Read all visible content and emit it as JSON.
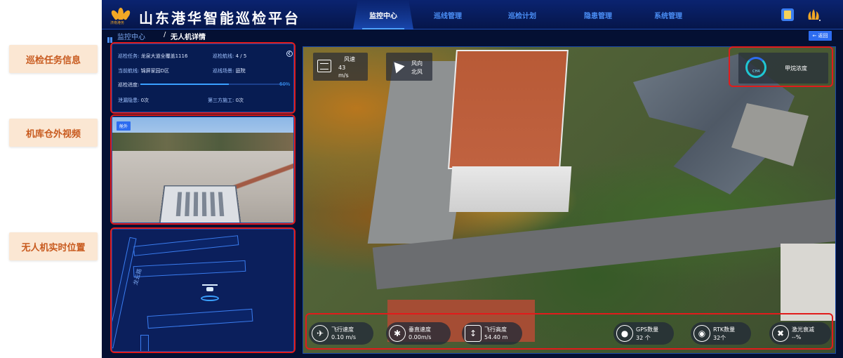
{
  "callouts": {
    "task_info": "巡检任务信息",
    "hangar_video": "机库仓外视频",
    "drone_position": "无人机实时位置"
  },
  "header": {
    "logo_subtext": "济南港务",
    "title": "山东港华智能巡检平台",
    "nav": [
      {
        "label": "监控中心",
        "active": true
      },
      {
        "label": "巡线管理",
        "active": false
      },
      {
        "label": "巡检计划",
        "active": false
      },
      {
        "label": "隐患管理",
        "active": false
      },
      {
        "label": "系统管理",
        "active": false
      }
    ],
    "icons": [
      "report-icon",
      "brand-logo-icon"
    ]
  },
  "breadcrumb": {
    "root": "监控中心",
    "separator": "/",
    "current": "无人机详情",
    "back_label": "← 返回"
  },
  "task_panel": {
    "task_label": "巡检任务:",
    "task_value": "龙泉大道全覆盖1116",
    "route_label": "巡检航线:",
    "route_value": "4 / 5",
    "current_route_label": "当前航线:",
    "current_route_value": "锦屏家园D区",
    "scene_label": "巡线场景:",
    "scene_value": "庭院",
    "progress_label": "巡检进度:",
    "progress_percent": 60,
    "progress_text": "60%",
    "leak_label": "泄漏隐患:",
    "leak_value": "0次",
    "third_party_label": "第三方施工:",
    "third_party_value": "0次"
  },
  "video_panel": {
    "badge": "舱外"
  },
  "map_panel": {
    "road_label": "龙云路"
  },
  "main_view": {
    "wind_speed_label": "风速",
    "wind_speed_value": "43",
    "wind_speed_unit": "m/s",
    "wind_dir_label": "风向",
    "wind_dir_value": "北风",
    "gas_ring_label": "CH4",
    "gas_title": "甲烷浓度",
    "stats": [
      {
        "icon": "plane-icon",
        "title": "飞行速度",
        "value": "0.10 m/s"
      },
      {
        "icon": "vertical-speed-icon",
        "title": "垂直速度",
        "value": "0.00m/s"
      },
      {
        "icon": "altitude-icon",
        "title": "飞行高度",
        "value": "54.40 m"
      },
      {
        "icon": "gps-icon",
        "title": "GPS数量",
        "value": "32 个"
      },
      {
        "icon": "rtk-icon",
        "title": "RTK数量",
        "value": "32个"
      },
      {
        "icon": "laser-icon",
        "title": "激光衰减",
        "value": "--%"
      }
    ]
  },
  "colors": {
    "accent": "#2d6cf0",
    "highlight": "#e11b1b",
    "callout_text": "#c85a1e",
    "callout_bg": "#fbe7d3"
  }
}
